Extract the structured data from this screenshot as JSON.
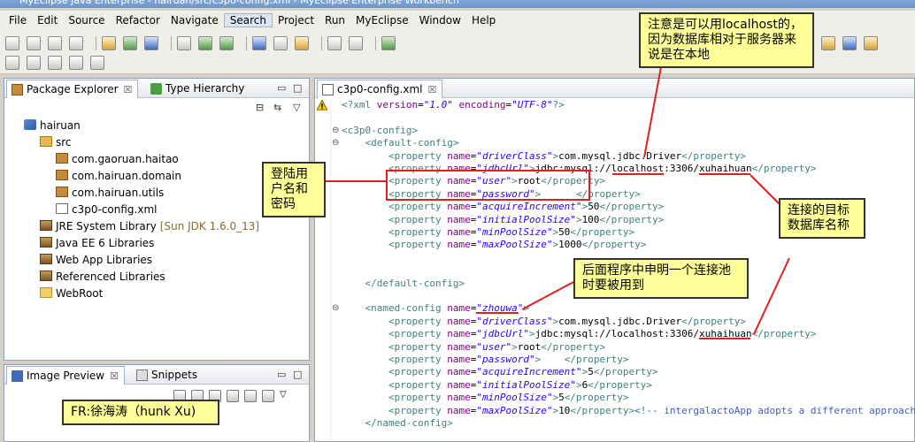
{
  "window": {
    "title": "MyEclipse Java Enterprise - hairuan/src/c3p0-config.xml - MyEclipse Enterprise Workbench"
  },
  "menu": [
    "File",
    "Edit",
    "Source",
    "Refactor",
    "Navigate",
    "Search",
    "Project",
    "Run",
    "MyEclipse",
    "Window",
    "Help"
  ],
  "left_panel": {
    "tabs": [
      {
        "label": "Package Explorer",
        "close": "☒"
      },
      {
        "label": "Type Hierarchy"
      }
    ],
    "tree": [
      {
        "label": "hairuan",
        "icon": "project"
      },
      {
        "label": "src",
        "icon": "src"
      },
      {
        "label": "com.gaoruan.haitao",
        "icon": "package"
      },
      {
        "label": "com.hairuan.domain",
        "icon": "package"
      },
      {
        "label": "com.hairuan.utils",
        "icon": "package"
      },
      {
        "label": "c3p0-config.xml",
        "icon": "xml-file"
      },
      {
        "label": "JRE System Library",
        "suffix": "[Sun JDK 1.6.0_13]",
        "icon": "library"
      },
      {
        "label": "Java EE 6 Libraries",
        "icon": "library"
      },
      {
        "label": "Web App Libraries",
        "icon": "library"
      },
      {
        "label": "Referenced Libraries",
        "icon": "library"
      },
      {
        "label": "WebRoot",
        "icon": "folder"
      }
    ]
  },
  "bottom_panel": {
    "tabs": [
      {
        "label": "Image Preview",
        "close": "☒"
      },
      {
        "label": "Snippets"
      }
    ]
  },
  "editor": {
    "tab": {
      "label": "c3p0-config.xml",
      "close": "☒"
    },
    "lines": [
      {
        "parts": [
          [
            "tg",
            "<?xml "
          ],
          [
            "an",
            "version"
          ],
          [
            "p",
            "="
          ],
          [
            "av",
            "\"1.0\""
          ],
          [
            "p",
            " "
          ],
          [
            "an",
            "encoding"
          ],
          [
            "p",
            "="
          ],
          [
            "av",
            "\"UTF-8\""
          ],
          [
            "tg",
            "?>"
          ]
        ]
      },
      {
        "parts": []
      },
      {
        "parts": [
          [
            "tg",
            "<c3p0-config>"
          ]
        ]
      },
      {
        "parts": [
          [
            "p",
            "    "
          ],
          [
            "tg",
            "<default-config>"
          ]
        ]
      },
      {
        "parts": [
          [
            "p",
            "        "
          ],
          [
            "tg",
            "<property "
          ],
          [
            "an",
            "name"
          ],
          [
            "p",
            "="
          ],
          [
            "av",
            "\"driverClass\""
          ],
          [
            "tg",
            ">"
          ],
          [
            "p",
            "com.mysql.jdbc.Driver"
          ],
          [
            "tg",
            "</property>"
          ]
        ]
      },
      {
        "parts": [
          [
            "p",
            "        "
          ],
          [
            "tg",
            "<property "
          ],
          [
            "an",
            "name"
          ],
          [
            "p",
            "="
          ],
          [
            "av",
            "\"jdbcUrl\""
          ],
          [
            "tg",
            ">"
          ],
          [
            "p",
            "jdbc:mysql://localhost:3306/xuhaihuan"
          ],
          [
            "tg",
            "</property>"
          ]
        ]
      },
      {
        "parts": [
          [
            "p",
            "        "
          ],
          [
            "tg",
            "<property "
          ],
          [
            "an",
            "name"
          ],
          [
            "p",
            "="
          ],
          [
            "av",
            "\"user\""
          ],
          [
            "tg",
            ">"
          ],
          [
            "p",
            "root"
          ],
          [
            "tg",
            "</property>"
          ]
        ]
      },
      {
        "parts": [
          [
            "p",
            "        "
          ],
          [
            "tg",
            "<property "
          ],
          [
            "an",
            "name"
          ],
          [
            "p",
            "="
          ],
          [
            "av",
            "\"password\""
          ],
          [
            "tg",
            ">"
          ],
          [
            "p",
            "      "
          ],
          [
            "tg",
            "</property>"
          ]
        ]
      },
      {
        "parts": [
          [
            "p",
            "        "
          ],
          [
            "tg",
            "<property "
          ],
          [
            "an",
            "name"
          ],
          [
            "p",
            "="
          ],
          [
            "av",
            "\"acquireIncrement\""
          ],
          [
            "tg",
            ">"
          ],
          [
            "p",
            "50"
          ],
          [
            "tg",
            "</property>"
          ]
        ]
      },
      {
        "parts": [
          [
            "p",
            "        "
          ],
          [
            "tg",
            "<property "
          ],
          [
            "an",
            "name"
          ],
          [
            "p",
            "="
          ],
          [
            "av",
            "\"initialPoolSize\""
          ],
          [
            "tg",
            ">"
          ],
          [
            "p",
            "100"
          ],
          [
            "tg",
            "</property>"
          ]
        ]
      },
      {
        "parts": [
          [
            "p",
            "        "
          ],
          [
            "tg",
            "<property "
          ],
          [
            "an",
            "name"
          ],
          [
            "p",
            "="
          ],
          [
            "av",
            "\"minPoolSize\""
          ],
          [
            "tg",
            ">"
          ],
          [
            "p",
            "50"
          ],
          [
            "tg",
            "</property>"
          ]
        ]
      },
      {
        "parts": [
          [
            "p",
            "        "
          ],
          [
            "tg",
            "<property "
          ],
          [
            "an",
            "name"
          ],
          [
            "p",
            "="
          ],
          [
            "av",
            "\"maxPoolSize\""
          ],
          [
            "tg",
            ">"
          ],
          [
            "p",
            "1000"
          ],
          [
            "tg",
            "</property>"
          ]
        ]
      },
      {
        "parts": []
      },
      {
        "parts": []
      },
      {
        "parts": [
          [
            "p",
            "    "
          ],
          [
            "tg",
            "</default-config>"
          ]
        ]
      },
      {
        "parts": []
      },
      {
        "parts": [
          [
            "p",
            "    "
          ],
          [
            "tg",
            "<named-config "
          ],
          [
            "an",
            "name"
          ],
          [
            "p",
            "="
          ],
          [
            "av",
            "\"zhouwa\""
          ],
          [
            "tg",
            ">"
          ]
        ]
      },
      {
        "parts": [
          [
            "p",
            "        "
          ],
          [
            "tg",
            "<property "
          ],
          [
            "an",
            "name"
          ],
          [
            "p",
            "="
          ],
          [
            "av",
            "\"driverClass\""
          ],
          [
            "tg",
            ">"
          ],
          [
            "p",
            "com.mysql.jdbc.Driver"
          ],
          [
            "tg",
            "</property>"
          ]
        ]
      },
      {
        "parts": [
          [
            "p",
            "        "
          ],
          [
            "tg",
            "<property "
          ],
          [
            "an",
            "name"
          ],
          [
            "p",
            "="
          ],
          [
            "av",
            "\"jdbcUrl\""
          ],
          [
            "tg",
            ">"
          ],
          [
            "p",
            "jdbc:mysql://localhost:3306/xuhaihuan"
          ],
          [
            "tg",
            "</property>"
          ]
        ]
      },
      {
        "parts": [
          [
            "p",
            "        "
          ],
          [
            "tg",
            "<property "
          ],
          [
            "an",
            "name"
          ],
          [
            "p",
            "="
          ],
          [
            "av",
            "\"user\""
          ],
          [
            "tg",
            ">"
          ],
          [
            "p",
            "root"
          ],
          [
            "tg",
            "</property>"
          ]
        ]
      },
      {
        "parts": [
          [
            "p",
            "        "
          ],
          [
            "tg",
            "<property "
          ],
          [
            "an",
            "name"
          ],
          [
            "p",
            "="
          ],
          [
            "av",
            "\"password\""
          ],
          [
            "tg",
            ">"
          ],
          [
            "p",
            "    "
          ],
          [
            "tg",
            "</property>"
          ]
        ]
      },
      {
        "parts": [
          [
            "p",
            "        "
          ],
          [
            "tg",
            "<property "
          ],
          [
            "an",
            "name"
          ],
          [
            "p",
            "="
          ],
          [
            "av",
            "\"acquireIncrement\""
          ],
          [
            "tg",
            ">"
          ],
          [
            "p",
            "5"
          ],
          [
            "tg",
            "</property>"
          ]
        ]
      },
      {
        "parts": [
          [
            "p",
            "        "
          ],
          [
            "tg",
            "<property "
          ],
          [
            "an",
            "name"
          ],
          [
            "p",
            "="
          ],
          [
            "av",
            "\"initialPoolSize\""
          ],
          [
            "tg",
            ">"
          ],
          [
            "p",
            "6"
          ],
          [
            "tg",
            "</property>"
          ]
        ]
      },
      {
        "parts": [
          [
            "p",
            "        "
          ],
          [
            "tg",
            "<property "
          ],
          [
            "an",
            "name"
          ],
          [
            "p",
            "="
          ],
          [
            "av",
            "\"minPoolSize\""
          ],
          [
            "tg",
            ">"
          ],
          [
            "p",
            "5"
          ],
          [
            "tg",
            "</property>"
          ]
        ]
      },
      {
        "parts": [
          [
            "p",
            "        "
          ],
          [
            "tg",
            "<property "
          ],
          [
            "an",
            "name"
          ],
          [
            "p",
            "="
          ],
          [
            "av",
            "\"maxPoolSize\""
          ],
          [
            "tg",
            ">"
          ],
          [
            "p",
            "10"
          ],
          [
            "tg",
            "</property>"
          ],
          [
            "cm",
            "<!-- intergalactoApp adopts a different approach"
          ]
        ]
      },
      {
        "parts": [
          [
            "p",
            "    "
          ],
          [
            "tg",
            "</named-config>"
          ]
        ]
      }
    ]
  },
  "annotations": {
    "localhost_note": "注意是可以用localhost的，因为数据库相对于服务器来说是在本地",
    "login_note": "登陆用户名和密码",
    "db_note": "连接的目标数据库名称",
    "pool_note": "后面程序中申明一个连接池时要被用到",
    "author_note": "FR:徐海涛（hunk Xu)"
  },
  "colors": {
    "callout_bg": "#ffff99",
    "highlight_red": "#e02020"
  }
}
